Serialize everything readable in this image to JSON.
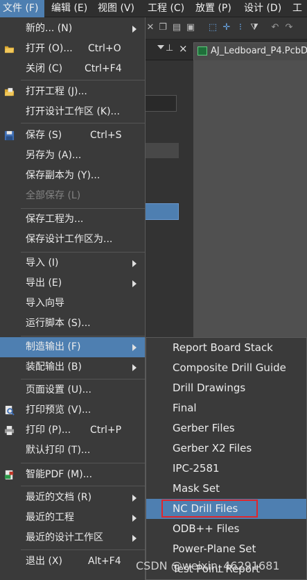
{
  "menubar": {
    "items": [
      "文件 (F)",
      "编辑 (E)",
      "视图 (V)",
      "工程 (C)",
      "放置 (P)",
      "设计 (D)",
      "工"
    ]
  },
  "document_tab": {
    "title": "AJ_Ledboard_P4.PcbDoc"
  },
  "panel": {
    "pin_icon": "pin-icon",
    "close_glyph": "×"
  },
  "file_menu": {
    "items": [
      {
        "label": "新的... (N)",
        "shortcut": "",
        "submenu": true
      },
      {
        "label": "打开 (O)...",
        "shortcut": "Ctrl+O"
      },
      {
        "label": "关闭 (C)",
        "shortcut": "Ctrl+F4"
      },
      {
        "label": "打开工程 (J)..."
      },
      {
        "label": "打开设计工作区 (K)..."
      },
      {
        "label": "保存 (S)",
        "shortcut": "Ctrl+S"
      },
      {
        "label": "另存为 (A)..."
      },
      {
        "label": "保存副本为 (Y)..."
      },
      {
        "label": "全部保存 (L)",
        "disabled": true
      },
      {
        "label": "保存工程为..."
      },
      {
        "label": "保存设计工作区为..."
      },
      {
        "label": "导入 (I)",
        "submenu": true
      },
      {
        "label": "导出 (E)",
        "submenu": true
      },
      {
        "label": "导入向导"
      },
      {
        "label": "运行脚本 (S)..."
      },
      {
        "label": "制造输出 (F)",
        "submenu": true,
        "active": true
      },
      {
        "label": "装配输出 (B)",
        "submenu": true
      },
      {
        "label": "页面设置 (U)..."
      },
      {
        "label": "打印预览 (V)..."
      },
      {
        "label": "打印 (P)...",
        "shortcut": "Ctrl+P"
      },
      {
        "label": "默认打印 (T)..."
      },
      {
        "label": "智能PDF (M)..."
      },
      {
        "label": "最近的文档 (R)",
        "submenu": true
      },
      {
        "label": "最近的工程",
        "submenu": true
      },
      {
        "label": "最近的设计工作区",
        "submenu": true
      },
      {
        "label": "退出 (X)",
        "shortcut": "Alt+F4"
      }
    ]
  },
  "fab_submenu": {
    "items": [
      "Report Board Stack",
      "Composite Drill Guide",
      "Drill Drawings",
      "Final",
      "Gerber Files",
      "Gerber X2 Files",
      "IPC-2581",
      "Mask Set",
      "NC Drill Files",
      "ODB++ Files",
      "Power-Plane Set",
      "Test Point Report"
    ],
    "highlighted": "NC Drill Files"
  },
  "watermark": "CSDN @weixin_46291681",
  "colors": {
    "menu_bg": "#3a3a3a",
    "highlight": "#4e7fb1",
    "outline": "#e0262b"
  }
}
